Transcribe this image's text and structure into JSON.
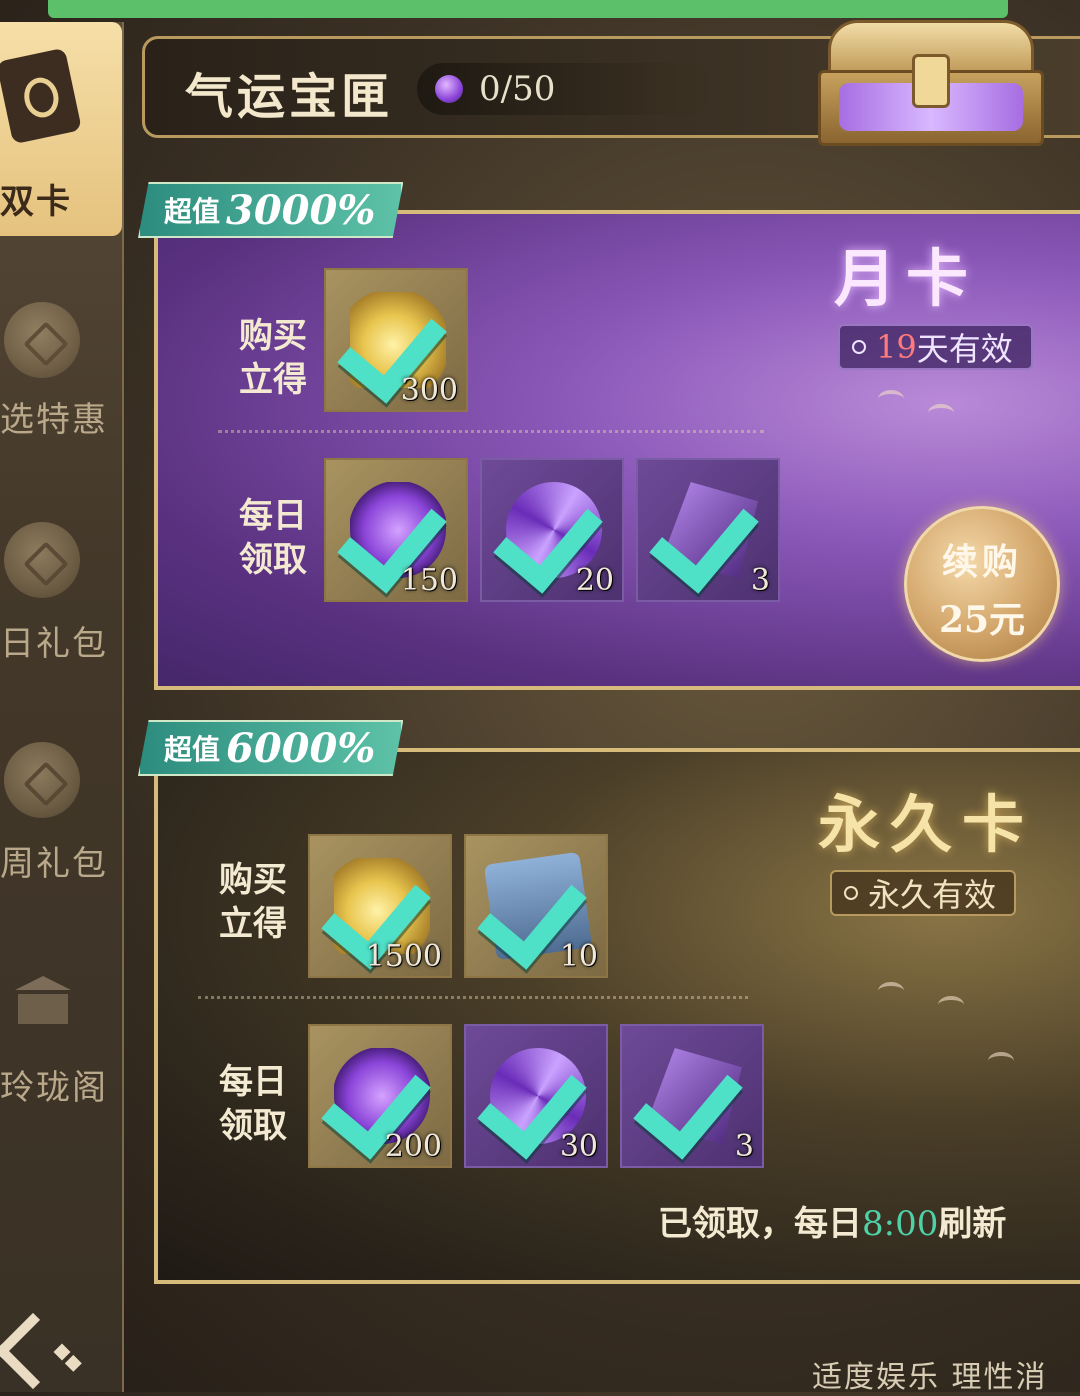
{
  "sidebar": {
    "items": [
      {
        "label": "双卡",
        "icon": "card-icon",
        "active": true
      },
      {
        "label": "选特惠",
        "icon": "coin-bag-icon"
      },
      {
        "label": "日礼包",
        "icon": "coin-bag-icon"
      },
      {
        "label": "周礼包",
        "icon": "coin-bag-icon"
      },
      {
        "label": "玲珑阁",
        "icon": "pavilion-icon"
      }
    ],
    "back_icon": "back-icon"
  },
  "header": {
    "title": "气运宝匣",
    "counter": "0/50",
    "gem_icon": "purple-gem-icon",
    "chest_icon": "treasure-chest-icon"
  },
  "month_card": {
    "badge_prefix": "超值",
    "badge_value": "3000%",
    "name": "月卡",
    "validity_days": "19",
    "validity_suffix": "天有效",
    "buy_label": [
      "购买",
      "立得"
    ],
    "daily_label": [
      "每日",
      "领取"
    ],
    "buy_items": [
      {
        "icon": "gold-flame-icon",
        "qty": "300",
        "claimed": true
      }
    ],
    "daily_items": [
      {
        "icon": "purple-heart-gem-icon",
        "qty": "150",
        "claimed": true
      },
      {
        "icon": "purple-swirl-orb-icon",
        "qty": "20",
        "claimed": true
      },
      {
        "icon": "purple-crystal-icon",
        "qty": "3",
        "claimed": true
      }
    ],
    "renew_label": "续购",
    "renew_price": "25元"
  },
  "permanent_card": {
    "badge_prefix": "超值",
    "badge_value": "6000%",
    "name": "永久卡",
    "validity": "永久有效",
    "buy_label": [
      "购买",
      "立得"
    ],
    "daily_label": [
      "每日",
      "领取"
    ],
    "buy_items": [
      {
        "icon": "gold-flame-icon",
        "qty": "1500",
        "claimed": true
      },
      {
        "icon": "blue-scroll-icon",
        "qty": "10",
        "claimed": true
      }
    ],
    "daily_items": [
      {
        "icon": "purple-heart-gem-icon",
        "qty": "200",
        "claimed": true
      },
      {
        "icon": "purple-swirl-orb-icon",
        "qty": "30",
        "claimed": true
      },
      {
        "icon": "purple-crystal-icon",
        "qty": "3",
        "claimed": true
      }
    ],
    "claimed_prefix": "已领取，每日",
    "claimed_time": "8:00",
    "claimed_suffix": "刷新"
  },
  "footer": {
    "note": "适度娱乐 理性消"
  },
  "colors": {
    "accent_teal": "#4fe0c8",
    "badge_teal": "#2c8c7e",
    "month_purple": "#8a58b8",
    "gold_border": "#d7bb7a",
    "days_red": "#ff7a7a"
  }
}
